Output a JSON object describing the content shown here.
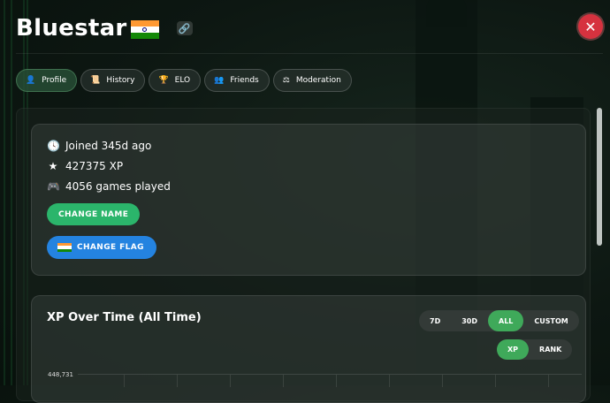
{
  "header": {
    "title": "Bluestar",
    "flag_colors": [
      "#ff9933",
      "#ffffff",
      "#138808"
    ],
    "link_icon": "link-icon",
    "close_icon": "close-icon",
    "close_color": "#d6323f"
  },
  "tabs": [
    {
      "label": "Profile",
      "icon": "user-icon",
      "active": true
    },
    {
      "label": "History",
      "icon": "scroll-icon",
      "active": false
    },
    {
      "label": "ELO",
      "icon": "trophy-icon",
      "active": false
    },
    {
      "label": "Friends",
      "icon": "friends-icon",
      "active": false
    },
    {
      "label": "Moderation",
      "icon": "gavel-icon",
      "active": false
    }
  ],
  "profile": {
    "joined": "Joined 345d ago",
    "xp": "427375 XP",
    "games": "4056 games played",
    "change_name_label": "CHANGE NAME",
    "change_flag_label": "CHANGE FLAG",
    "change_name_color": "#2bb56b",
    "change_flag_color": "#2483e0"
  },
  "chart": {
    "title": "XP Over Time (All Time)",
    "ranges": [
      {
        "label": "7D",
        "active": false
      },
      {
        "label": "30D",
        "active": false
      },
      {
        "label": "ALL",
        "active": true
      },
      {
        "label": "CUSTOM",
        "active": false
      }
    ],
    "metrics": [
      {
        "label": "XP",
        "active": true
      },
      {
        "label": "RANK",
        "active": false
      }
    ],
    "y_top_tick": "448,731",
    "accent": "#3fa95a"
  }
}
